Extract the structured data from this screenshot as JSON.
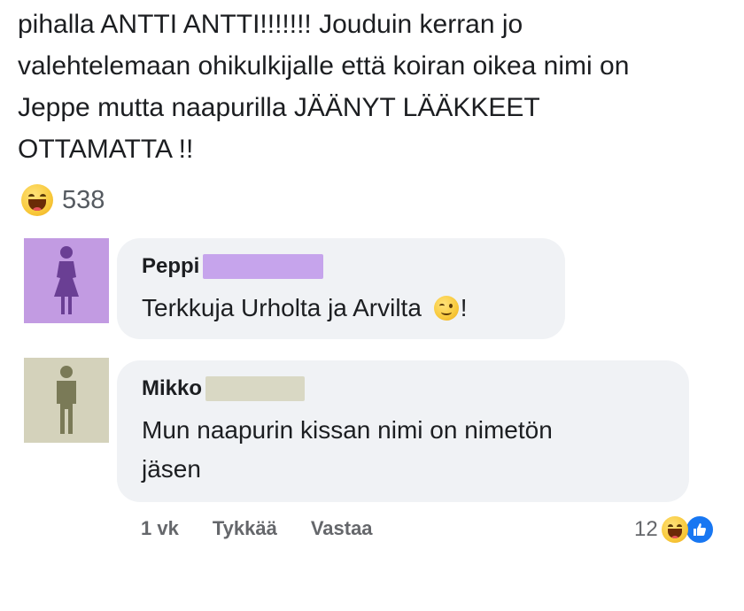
{
  "post": {
    "text": "pihalla  ANTTI ANTTI!!!!!!! Jouduin kerran jo\nvalehtelemaan ohikulkijalle että koiran oikea nimi on\nJeppe mutta naapurilla JÄÄNYT LÄÄKKEET\nOTTAMATTA !!",
    "reaction_icon": "laughing-emoji-icon",
    "reaction_count": "538"
  },
  "comments": [
    {
      "author": "Peppi",
      "text_before_emoji": "Terkkuja Urholta ja Arvilta ",
      "emoji": "winking-face-icon",
      "text_after_emoji": "!",
      "avatar_icon": "female-silhouette-icon",
      "avatar_color": "#c29be2",
      "redaction_color": "#c6a4ec"
    },
    {
      "author": "Mikko",
      "text": "Mun naapurin kissan nimi on nimetön\njäsen",
      "avatar_icon": "male-silhouette-icon",
      "avatar_color": "#d4d2bb",
      "redaction_color": "#d9d8c4",
      "time": "1 vk",
      "like_label": "Tykkää",
      "reply_label": "Vastaa",
      "reaction_count": "12",
      "reaction_icons": [
        "laughing-emoji-icon",
        "like-icon"
      ]
    }
  ],
  "colors": {
    "bubble_bg": "#f0f2f5",
    "like_blue": "#1877f2",
    "meta_text": "#65676b"
  }
}
